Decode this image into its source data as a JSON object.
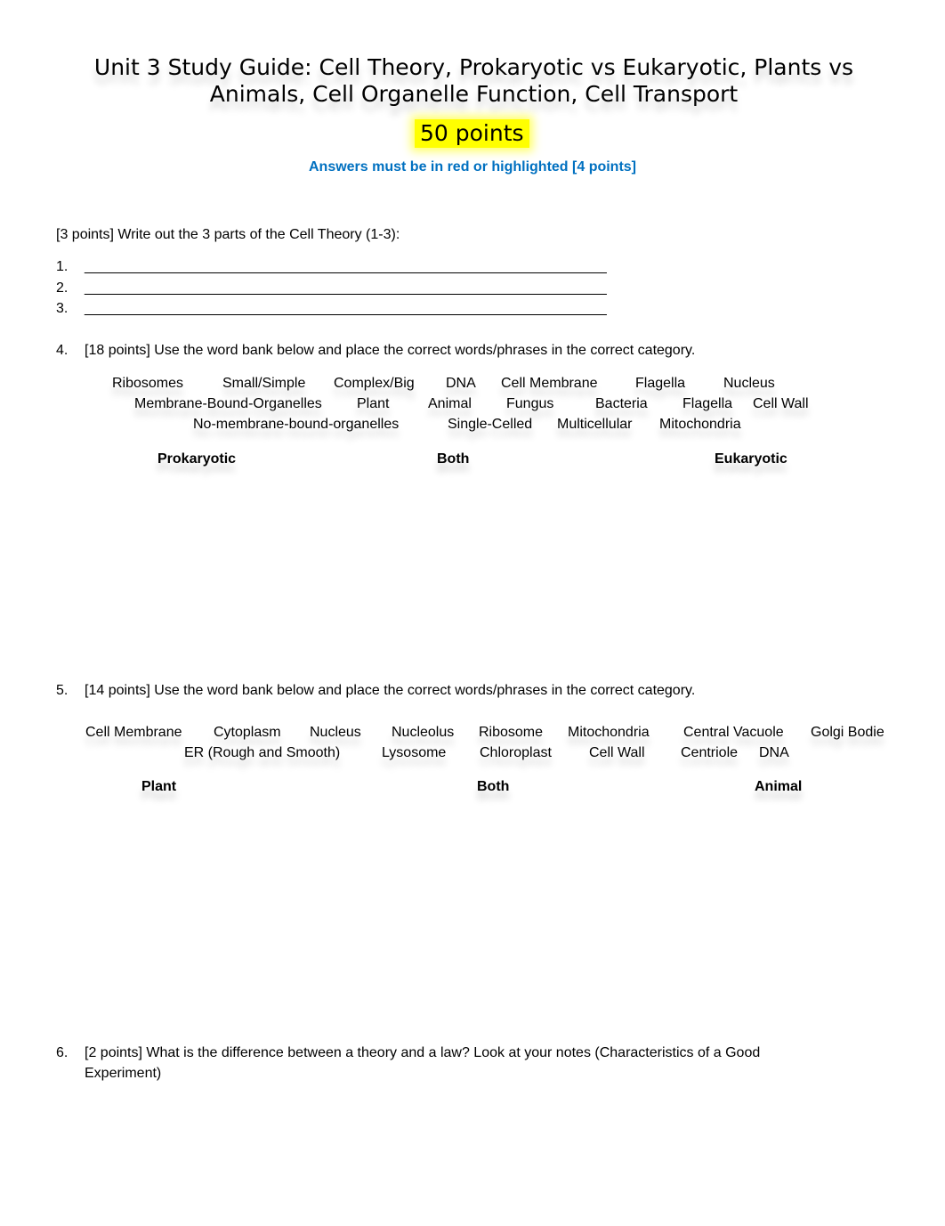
{
  "header": {
    "title": "Unit 3 Study Guide: Cell Theory, Prokaryotic vs Eukaryotic, Plants vs Animals, Cell Organelle Function, Cell Transport",
    "points_badge": "50 points",
    "instructions": "Answers must be in red or highlighted [4 points]",
    "highlight_color": "#ffff00",
    "instructions_color": "#0070c0"
  },
  "cell_theory": {
    "prompt": "[3 points] Write out the 3 parts of the Cell Theory (1-3):",
    "items": [
      {
        "number": "1.",
        "blank": "_____________________________________________________________________"
      },
      {
        "number": "2.",
        "blank": "_____________________________________________________________________"
      },
      {
        "number": "3.",
        "blank": "_____________________________________________________________________"
      }
    ]
  },
  "q4": {
    "number": "4.",
    "prompt": "[18 points] Use the word bank below and place the correct words/phrases in the correct category.",
    "word_bank": {
      "row1": [
        "Ribosomes",
        "Small/Simple",
        "Complex/Big",
        "DNA",
        "Cell Membrane",
        "Flagella",
        "Nucleus"
      ],
      "row2": [
        "Membrane-Bound-Organelles",
        "Plant",
        "Animal",
        "Fungus",
        "Bacteria",
        "Flagella",
        "Cell Wall"
      ],
      "row3": [
        "No-membrane-bound-organelles",
        "Single-Celled",
        "Multicellular",
        "Mitochondria"
      ]
    },
    "categories": [
      "Prokaryotic",
      "Both",
      "Eukaryotic"
    ]
  },
  "q5": {
    "number": "5.",
    "prompt": "[14 points] Use the word bank below and place the correct words/phrases in the correct category.",
    "word_bank": {
      "row1": [
        "Cell Membrane",
        "Cytoplasm",
        "Nucleus",
        "Nucleolus",
        "Ribosome",
        "Mitochondria",
        "Central Vacuole",
        "Golgi Bodie"
      ],
      "row2": [
        "ER (Rough and Smooth)",
        "Lysosome",
        "Chloroplast",
        "Cell Wall",
        "Centriole",
        "DNA"
      ]
    },
    "categories": [
      "Plant",
      "Both",
      "Animal"
    ]
  },
  "q6": {
    "number": "6.",
    "prompt_line1": "[2 points] What is the difference between a theory and a law? Look at your notes (Characteristics of a Good",
    "prompt_line2": "Experiment)"
  }
}
